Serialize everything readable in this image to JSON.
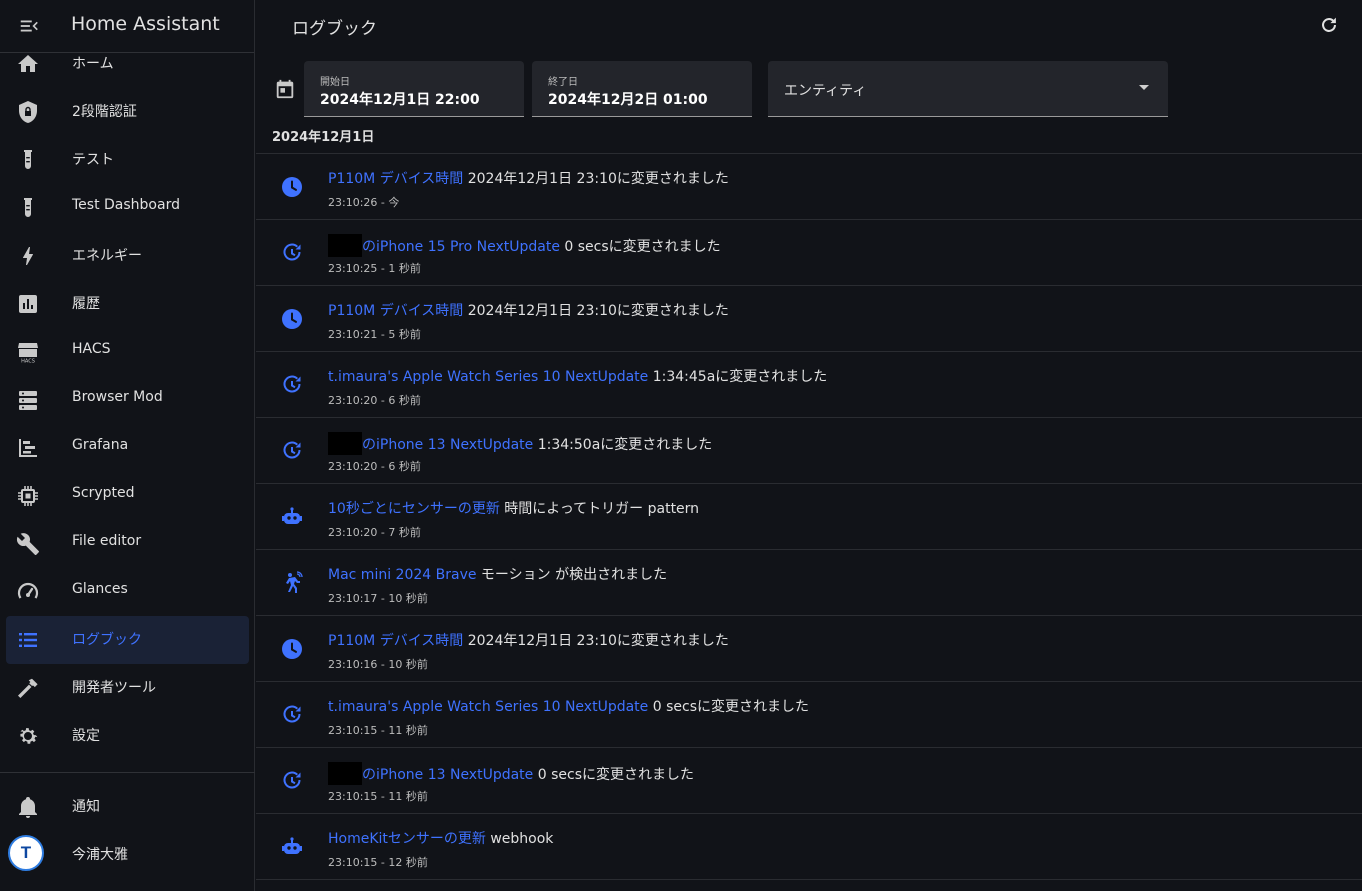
{
  "app": {
    "title": "Home Assistant"
  },
  "sidebar": {
    "items": [
      {
        "label": "ホーム",
        "icon": "home-icon"
      },
      {
        "label": "2段階認証",
        "icon": "shield-lock-icon"
      },
      {
        "label": "テスト",
        "icon": "test-tube-icon"
      },
      {
        "label": "Test Dashboard",
        "icon": "test-tube-icon"
      },
      {
        "label": "エネルギー",
        "icon": "lightning-bolt-icon"
      },
      {
        "label": "履歴",
        "icon": "chart-box-icon"
      },
      {
        "label": "HACS",
        "icon": "hacs-icon"
      },
      {
        "label": "Browser Mod",
        "icon": "server-icon"
      },
      {
        "label": "Grafana",
        "icon": "chart-gantt-icon"
      },
      {
        "label": "Scrypted",
        "icon": "chip-icon"
      },
      {
        "label": "File editor",
        "icon": "wrench-icon"
      },
      {
        "label": "Glances",
        "icon": "speedometer-icon"
      },
      {
        "label": "ログブック",
        "icon": "format-list-bulleted-icon",
        "active": true
      },
      {
        "label": "開発者ツール",
        "icon": "hammer-icon"
      },
      {
        "label": "設定",
        "icon": "cog-icon"
      }
    ],
    "notifications_label": "通知",
    "user": {
      "name": "今浦大雅",
      "initials": "T"
    }
  },
  "page": {
    "title": "ログブック",
    "start": {
      "label": "開始日",
      "value": "2024年12月1日 22:00"
    },
    "end": {
      "label": "終了日",
      "value": "2024年12月2日 01:00"
    },
    "entity_placeholder": "エンティティ",
    "date_heading": "2024年12月1日"
  },
  "entries": [
    {
      "icon": "clock-icon",
      "redacted": false,
      "entity": "P110M デバイス時間",
      "message": " 2024年12月1日 23:10に変更されました",
      "meta": "23:10:26 - 今"
    },
    {
      "icon": "update-icon",
      "redacted": true,
      "entity": "のiPhone 15 Pro NextUpdate",
      "message": " 0 secsに変更されました",
      "meta": "23:10:25 - 1 秒前"
    },
    {
      "icon": "clock-icon",
      "redacted": false,
      "entity": "P110M デバイス時間",
      "message": " 2024年12月1日 23:10に変更されました",
      "meta": "23:10:21 - 5 秒前"
    },
    {
      "icon": "update-icon",
      "redacted": false,
      "entity": "t.imaura's Apple Watch Series 10 NextUpdate",
      "message": " 1:34:45aに変更されました",
      "meta": "23:10:20 - 6 秒前"
    },
    {
      "icon": "update-icon",
      "redacted": true,
      "entity": "のiPhone 13 NextUpdate",
      "message": " 1:34:50aに変更されました",
      "meta": "23:10:20 - 6 秒前"
    },
    {
      "icon": "robot-icon",
      "redacted": false,
      "entity": "10秒ごとにセンサーの更新",
      "message": " 時間によってトリガー pattern",
      "meta": "23:10:20 - 7 秒前"
    },
    {
      "icon": "motion-sensor-icon",
      "redacted": false,
      "entity": "Mac mini 2024 Brave",
      "message": " モーション が検出されました",
      "meta": "23:10:17 - 10 秒前"
    },
    {
      "icon": "clock-icon",
      "redacted": false,
      "entity": "P110M デバイス時間",
      "message": " 2024年12月1日 23:10に変更されました",
      "meta": "23:10:16 - 10 秒前"
    },
    {
      "icon": "update-icon",
      "redacted": false,
      "entity": "t.imaura's Apple Watch Series 10 NextUpdate",
      "message": " 0 secsに変更されました",
      "meta": "23:10:15 - 11 秒前"
    },
    {
      "icon": "update-icon",
      "redacted": true,
      "entity": "のiPhone 13 NextUpdate",
      "message": " 0 secsに変更されました",
      "meta": "23:10:15 - 11 秒前"
    },
    {
      "icon": "robot-icon",
      "redacted": false,
      "entity": "HomeKitセンサーの更新",
      "message": " webhook",
      "meta": "23:10:15 - 12 秒前"
    }
  ],
  "colors": {
    "accent": "#3f72ff",
    "background": "#111318",
    "field": "#23252b"
  }
}
